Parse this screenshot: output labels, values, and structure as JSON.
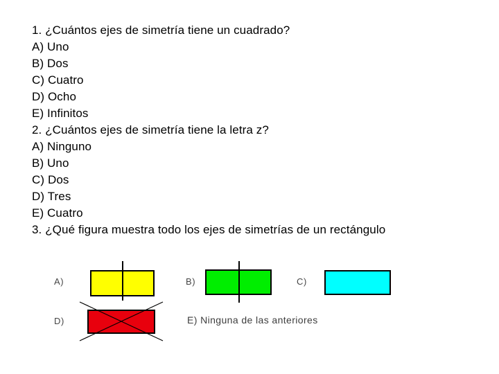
{
  "slide": {
    "background_color": "#ffffff",
    "text_color": "#000000"
  },
  "question_lines": [
    {
      "id": "q1-prompt",
      "text": "1. ¿Cuántos ejes de simetría tiene un cuadrado?"
    },
    {
      "id": "q1-opt-a",
      "text": "A) Uno"
    },
    {
      "id": "q1-opt-b",
      "text": "B) Dos"
    },
    {
      "id": "q1-opt-c",
      "text": "C) Cuatro"
    },
    {
      "id": "q1-opt-d",
      "text": "D) Ocho"
    },
    {
      "id": "q1-opt-e",
      "text": "E) Infinitos"
    },
    {
      "id": "q2-prompt",
      "text": "2. ¿Cuántos ejes de simetría tiene la letra z?"
    },
    {
      "id": "q2-opt-a",
      "text": "A) Ninguno"
    },
    {
      "id": "q2-opt-b",
      "text": "B) Uno"
    },
    {
      "id": "q2-opt-c",
      "text": "C) Dos"
    },
    {
      "id": "q2-opt-d",
      "text": "D) Tres"
    },
    {
      "id": "q2-opt-e",
      "text": "E) Cuatro"
    },
    {
      "id": "q3-prompt",
      "text": "3. ¿Qué figura muestra todo los ejes de simetrías de un rectángulo"
    }
  ],
  "figure_options": {
    "option_a": {
      "label": "A)",
      "fill_color": "#ffff00",
      "stroke_color": "#000000",
      "axis_count": 1,
      "axis_orientation": "vertical"
    },
    "option_b": {
      "label": "B)",
      "fill_color": "#00ee00",
      "stroke_color": "#000000",
      "axis_count": 1,
      "axis_orientation": "vertical"
    },
    "option_c": {
      "label": "C)",
      "fill_color": "#00ffff",
      "stroke_color": "#000000",
      "axis_count": 0,
      "axis_orientation": "none"
    },
    "option_d": {
      "label": "D)",
      "fill_color": "#e8000d",
      "stroke_color": "#000000",
      "axis_count": 2,
      "axis_orientation": "diagonal"
    },
    "option_e": {
      "label": "E) Ninguna de las anteriores"
    }
  }
}
